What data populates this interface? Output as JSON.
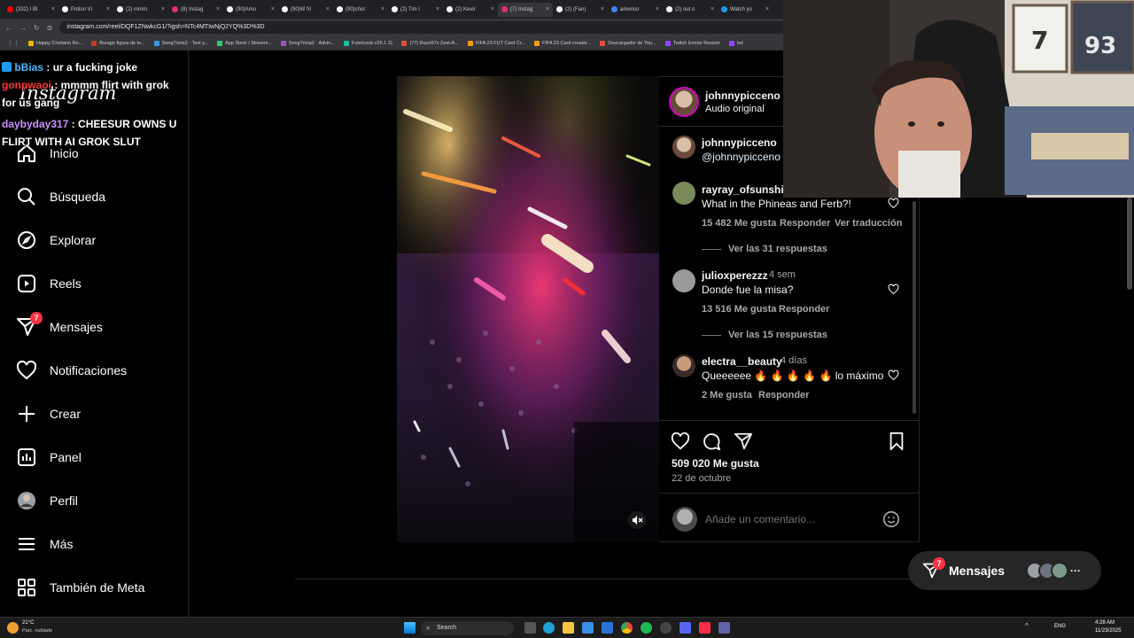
{
  "browser": {
    "tabs": [
      {
        "label": "(332) I Bl",
        "color": "#ff0000"
      },
      {
        "label": "Potion Vi",
        "color": "#ffffff"
      },
      {
        "label": "(2) mmm",
        "color": "#ffffff"
      },
      {
        "label": "(8) Instag",
        "color": "#e1306c"
      },
      {
        "label": "(90)Amo",
        "color": "#ffffff"
      },
      {
        "label": "(90)W fri",
        "color": "#ffffff"
      },
      {
        "label": "(90)chor",
        "color": "#ffffff"
      },
      {
        "label": "(2) Tim l",
        "color": "#ffffff"
      },
      {
        "label": "(2) Kevir",
        "color": "#ffffff"
      },
      {
        "label": "(7) Instag",
        "color": "#e1306c"
      },
      {
        "label": "(2) (Fan)",
        "color": "#ffffff"
      },
      {
        "label": "americo",
        "color": "#4285f4"
      },
      {
        "label": "(2) out o",
        "color": "#ffffff"
      },
      {
        "label": "Watch yo",
        "color": "#1d9bf0"
      }
    ],
    "url": "instagram.com/reel/DQF1ZNwkcG1/?igsh=NTc4MTIwNjQ2YQ%3D%3D",
    "bookmarks": [
      {
        "label": "Happy Cristiano Ro...",
        "color": "#f0b400"
      },
      {
        "label": "Burago figura de to...",
        "color": "#c0392b"
      },
      {
        "label": "SongTrivia2 - Test y...",
        "color": "#3498db"
      },
      {
        "label": "App Store / Streami...",
        "color": "#2ecc71"
      },
      {
        "label": "SongTrivia2 - Advin...",
        "color": "#9b59b6"
      },
      {
        "label": "Futetcoob v25.1.11",
        "color": "#1abc9c"
      },
      {
        "label": "(77) Razo97s Zest-A...",
        "color": "#e74c3c"
      },
      {
        "label": "FIFA 23 FUT Card Cr...",
        "color": "#f39c12"
      },
      {
        "label": "FIFA 23 Card creator...",
        "color": "#f39c12"
      },
      {
        "label": "Descargador de You...",
        "color": "#e74c3c"
      },
      {
        "label": "Twitch Emote Resizer",
        "color": "#9146ff"
      },
      {
        "label": "twi",
        "color": "#9146ff"
      }
    ]
  },
  "sidebar": {
    "logo": "Instagram",
    "items": [
      {
        "label": "Inicio",
        "icon": "home-icon"
      },
      {
        "label": "Búsqueda",
        "icon": "search-icon"
      },
      {
        "label": "Explorar",
        "icon": "compass-icon"
      },
      {
        "label": "Reels",
        "icon": "reels-icon"
      },
      {
        "label": "Mensajes",
        "icon": "messenger-icon",
        "badge": "7"
      },
      {
        "label": "Notificaciones",
        "icon": "heart-icon"
      },
      {
        "label": "Crear",
        "icon": "plus-icon"
      },
      {
        "label": "Panel",
        "icon": "chart-icon"
      },
      {
        "label": "Perfil",
        "icon": "avatar-icon"
      },
      {
        "label": "Más",
        "icon": "menu-icon"
      },
      {
        "label": "También de Meta",
        "icon": "meta-icon"
      }
    ]
  },
  "chat": [
    {
      "user": "bBias",
      "msg": " : ur a fucking joke"
    },
    {
      "user": "gonpwaoi",
      "msg": " : mmmm flirt with grok for us gang"
    },
    {
      "user": "daybyday317",
      "msg": " : CHEESUR OWNS U FLIRT WITH AI GROK SLUT"
    }
  ],
  "post": {
    "author": "johnnypicceno",
    "audio": "Audio original",
    "caption_user": "johnnypicceno",
    "caption_mention": "@johnnypicceno",
    "comments": [
      {
        "user": "rayray_ofsunshine",
        "time": "",
        "text": "What in the Phineas and Ferb?!",
        "likes": "15 482 Me gusta",
        "reply": "Responder",
        "translate": "Ver traducción",
        "replies": "Ver las 31 respuestas"
      },
      {
        "user": "julioxperezzz",
        "time": "4 sem",
        "text": "Donde fue la misa?",
        "likes": "13 516 Me gusta",
        "reply": "Responder",
        "translate": "",
        "replies": "Ver las 15 respuestas"
      },
      {
        "user": "electra__beauty",
        "time": "4 días",
        "text": "Queeeeee 🔥 🔥 🔥 🔥 🔥 lo máximo",
        "likes": "2 Me gusta",
        "reply": "Responder",
        "translate": "",
        "replies": ""
      }
    ],
    "like_count": "509 020 Me gusta",
    "date": "22 de octubre",
    "comment_placeholder": "Añade un comentario..."
  },
  "messages_pill": {
    "label": "Mensajes",
    "badge": "7"
  },
  "taskbar": {
    "weather_temp": "21°C",
    "weather_desc": "Parc. nublado",
    "search": "Search",
    "lang": "ENG",
    "time": "4:28 AM",
    "date": "11/23/2025"
  },
  "colors": {
    "accent_red": "#ff3040",
    "link_blue": "#e0f1ff",
    "muted": "#a8a8a8"
  }
}
